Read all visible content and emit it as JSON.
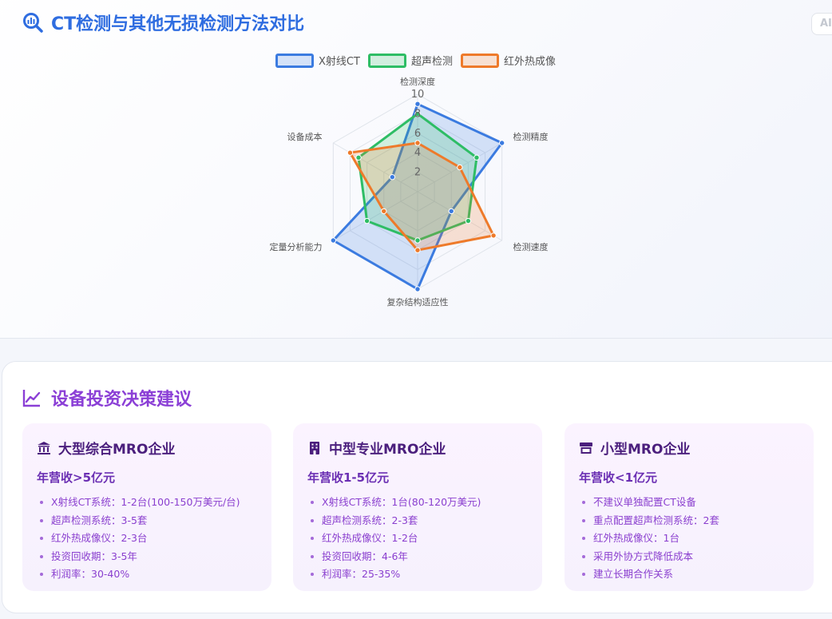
{
  "radar_section": {
    "title": "CT检测与其他无损检测方法对比",
    "badge": "AI"
  },
  "chart_data": {
    "type": "radar",
    "axes": [
      "检测深度",
      "检测精度",
      "检测速度",
      "复杂结构适应性",
      "定量分析能力",
      "设备成本"
    ],
    "tick_labels": [
      "2",
      "4",
      "6",
      "8",
      "10"
    ],
    "rmax": 10,
    "series": [
      {
        "name": "X射线CT",
        "values": [
          9,
          10,
          4,
          10,
          10,
          3
        ],
        "color": "#3b7be0",
        "fill": "rgba(59,123,224,0.20)"
      },
      {
        "name": "超声检测",
        "values": [
          8,
          7,
          6,
          5,
          6,
          7
        ],
        "color": "#2ebd65",
        "fill": "rgba(46,189,101,0.20)"
      },
      {
        "name": "红外热成像",
        "values": [
          5,
          5,
          9,
          6,
          4,
          8
        ],
        "color": "#ee7a2a",
        "fill": "rgba(238,122,42,0.20)"
      }
    ],
    "legend_position": "top",
    "grid": true
  },
  "decision_section": {
    "title": "设备投资决策建议",
    "tiers": [
      {
        "name": "大型综合MRO企业",
        "icon": "bank-icon",
        "revenue": "年营收>5亿元",
        "items": [
          "X射线CT系统：1-2台(100-150万美元/台)",
          "超声检测系统：3-5套",
          "红外热成像仪：2-3台",
          "投资回收期：3-5年",
          "利润率：30-40%"
        ]
      },
      {
        "name": "中型专业MRO企业",
        "icon": "building-icon",
        "revenue": "年营收1-5亿元",
        "items": [
          "X射线CT系统：1台(80-120万美元)",
          "超声检测系统：2-3套",
          "红外热成像仪：1-2台",
          "投资回收期：4-6年",
          "利润率：25-35%"
        ]
      },
      {
        "name": "小型MRO企业",
        "icon": "store-icon",
        "revenue": "年营收<1亿元",
        "items": [
          "不建议单独配置CT设备",
          "重点配置超声检测系统：2套",
          "红外热成像仪：1台",
          "采用外协方式降低成本",
          "建立长期合作关系"
        ]
      }
    ]
  }
}
